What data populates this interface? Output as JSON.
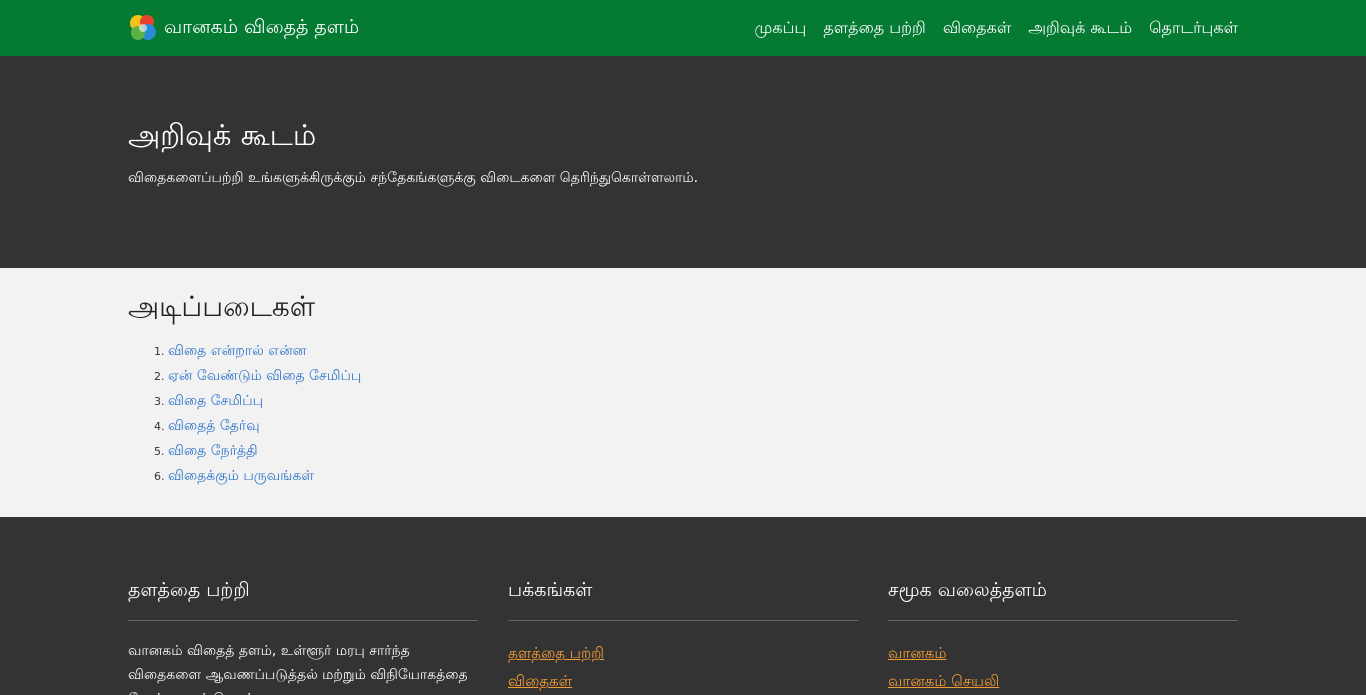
{
  "header": {
    "brand": "வானகம் விதைத் தளம்",
    "logo_icon": "multicolor-leaf-logo-icon",
    "nav": [
      "முகப்பு",
      "தளத்தை பற்றி",
      "விதைகள்",
      "அறிவுக் கூடம்",
      "தொடர்புகள்"
    ],
    "color": "#047a32"
  },
  "hero": {
    "title": "அறிவுக் கூடம்",
    "subtitle": "விதைகளைப்பற்றி உங்களுக்கிருக்கும் சந்தேகங்களுக்கு விடைகளை தெரிந்துகொள்ளலாம்."
  },
  "main": {
    "heading": "அடிப்படைகள்",
    "items": [
      "விதை என்றால் என்ன",
      "ஏன் வேண்டும் விதை சேமிப்பு",
      "விதை சேமிப்பு",
      "விதைத் தேர்வு",
      "விதை நேர்த்தி",
      "விதைக்கும் பருவங்கள்"
    ]
  },
  "footer": {
    "about": {
      "title": "தளத்தை பற்றி",
      "text": "வானகம் விதைத் தளம், உள்ளூர் மரபு சார்ந்த விதைகளை ஆவணப்படுத்தல் மற்றும் விநியோகத்தை நோக்கமாகக் கொண்டது"
    },
    "pages": {
      "title": "பக்கங்கள்",
      "links": [
        "தளத்தை பற்றி",
        "விதைகள்"
      ]
    },
    "social": {
      "title": "சமூக வலைத்தளம்",
      "links": [
        "வானகம்",
        "வானகம் செயலி"
      ]
    },
    "link_color": "#f39c34"
  }
}
